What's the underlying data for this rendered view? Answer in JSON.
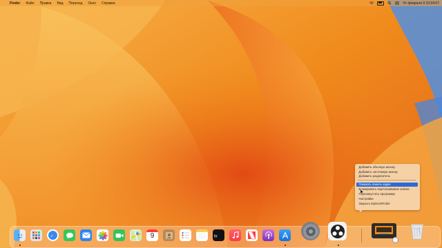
{
  "menubar": {
    "apple": "",
    "items": [
      "Finder",
      "Файл",
      "Правка",
      "Вид",
      "Переход",
      "Окно",
      "Справка"
    ],
    "clock": "Чт февраля 9  10:04:07"
  },
  "dock": {
    "calendar_day": "9",
    "apps": [
      "finder-icon",
      "launchpad-icon",
      "safari-icon",
      "messages-icon",
      "mail-icon",
      "photos-icon",
      "facetime-icon",
      "maps-icon",
      "calendar-icon",
      "contacts-icon",
      "reminders-icon",
      "notes-icon",
      "appletv-icon",
      "music-icon",
      "news-icon",
      "podcasts-icon",
      "appstore-icon",
      "system-settings-icon",
      "obs-icon",
      "mydockfinder-icon",
      "trash-icon"
    ]
  },
  "context_menu": {
    "items": [
      "Добавить обычную иконку",
      "Добавить системную иконку",
      "Добавить разделитель",
      "Показать панель задач",
      "Блокировать перетаскивание значка",
      "Перезапустить программу",
      "Настройки",
      "Закрыть MyDockFinder"
    ],
    "highlighted_index": 3
  },
  "colors": {
    "accent": "#2b6ad6",
    "wallpaper_main": "#f08a1c"
  }
}
